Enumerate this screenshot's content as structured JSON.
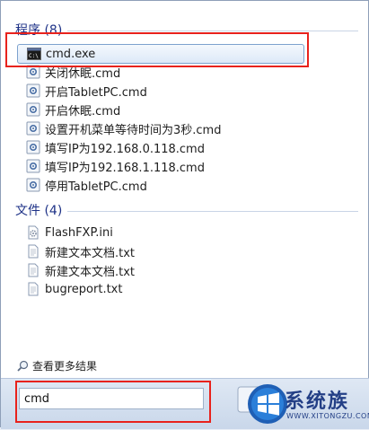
{
  "programs": {
    "header": "程序 (8)",
    "items": [
      {
        "label": "cmd.exe",
        "icon": "cmd-icon"
      },
      {
        "label": "关闭休眠.cmd",
        "icon": "script-icon"
      },
      {
        "label": "开启TabletPC.cmd",
        "icon": "script-icon"
      },
      {
        "label": "开启休眠.cmd",
        "icon": "script-icon"
      },
      {
        "label": "设置开机菜单等待时间为3秒.cmd",
        "icon": "script-icon"
      },
      {
        "label": "填写IP为192.168.0.118.cmd",
        "icon": "script-icon"
      },
      {
        "label": "填写IP为192.168.1.118.cmd",
        "icon": "script-icon"
      },
      {
        "label": "停用TabletPC.cmd",
        "icon": "script-icon"
      }
    ]
  },
  "files": {
    "header": "文件 (4)",
    "items": [
      {
        "label": "FlashFXP.ini",
        "icon": "ini-file-icon"
      },
      {
        "label": "新建文本文档.txt",
        "icon": "text-file-icon"
      },
      {
        "label": "新建文本文档.txt",
        "icon": "text-file-icon"
      },
      {
        "label": "bugreport.txt",
        "icon": "text-file-icon"
      }
    ]
  },
  "see_more": "查看更多结果",
  "search": {
    "value": "cmd"
  },
  "watermark": {
    "text": "系统族",
    "url": "WWW.XITONGZU.COM"
  },
  "colors": {
    "header": "#1e3287",
    "highlight_box": "#e8221c",
    "selection": "#dde9f8"
  }
}
